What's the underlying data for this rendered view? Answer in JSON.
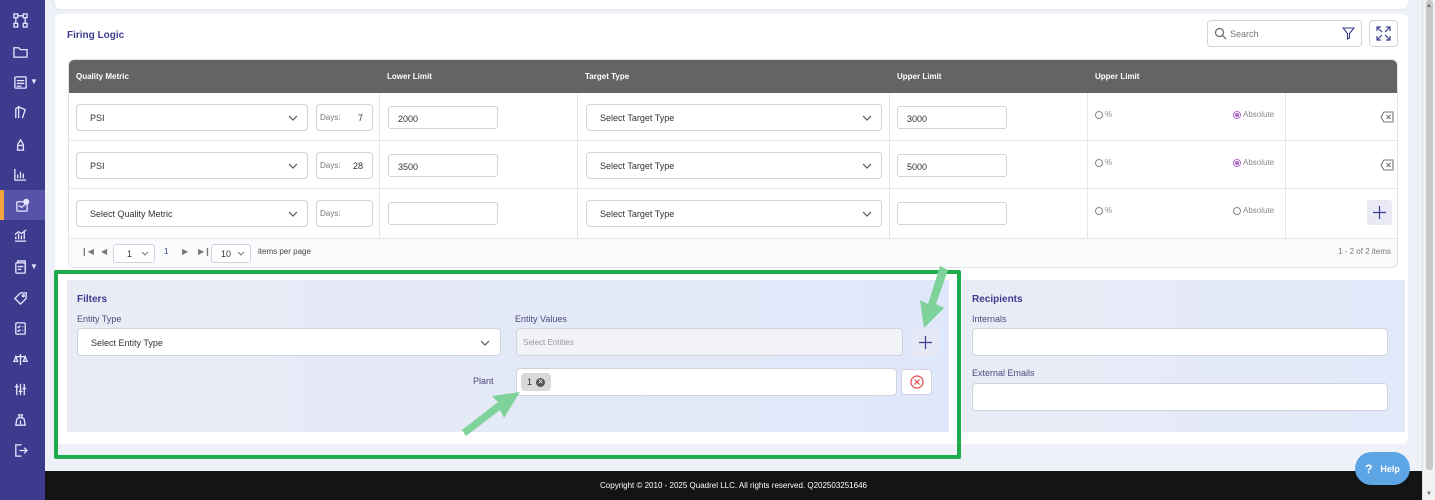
{
  "sidebar": {
    "icons": [
      "workflow-icon",
      "folder-icon",
      "form-icon",
      "document-edit-icon",
      "lab-icon",
      "bar-chart-icon",
      "alert-settings-icon",
      "analytics-chart-icon",
      "reports-icon",
      "tag-icon",
      "checklist-icon",
      "scale-icon",
      "sliders-icon",
      "money-bag-icon",
      "logout-icon"
    ],
    "active": "alert-settings-icon"
  },
  "section": {
    "title": "Firing Logic",
    "search_placeholder": "Search"
  },
  "grid": {
    "headers": [
      "Quality Metric",
      "Lower Limit",
      "Target Type",
      "Upper Limit",
      "Upper Limit"
    ],
    "rows": [
      {
        "metric": "PSI",
        "days_label": "Days:",
        "days": "7",
        "lower": "2000",
        "target": "Select Target Type",
        "upper": "3000",
        "pct_label": "%",
        "abs_label": "Absolute",
        "selected": "Absolute"
      },
      {
        "metric": "PSI",
        "days_label": "Days:",
        "days": "28",
        "lower": "3500",
        "target": "Select Target Type",
        "upper": "5000",
        "pct_label": "%",
        "abs_label": "Absolute",
        "selected": "Absolute"
      },
      {
        "metric": "Select Quality Metric",
        "days_label": "Days:",
        "days": "",
        "lower": "",
        "target": "Select Target Type",
        "upper": "",
        "pct_label": "%",
        "abs_label": "Absolute",
        "selected": ""
      }
    ],
    "pager": {
      "page_select": "1",
      "current_page": "1",
      "page_size": "10",
      "items_per_page_label": "items per page",
      "summary": "1 - 2 of 2 items"
    }
  },
  "filters": {
    "title": "Filters",
    "entity_type_label": "Entity Type",
    "entity_type_value": "Select Entity Type",
    "entity_values_label": "Entity Values",
    "entity_values_placeholder": "Select Entities",
    "plant_label": "Plant",
    "plant_chip": "1"
  },
  "recipients": {
    "title": "Recipients",
    "internals_label": "Internals",
    "external_label": "External Emails"
  },
  "footer": {
    "copyright": "Copyright © 2010 - 2025 Quadrel LLC. All rights reserved. Q202503251646"
  },
  "help": {
    "label": "Help"
  },
  "annotation": {
    "highlight_color": "#1faa4c",
    "arrow_color": "#7fd39a"
  },
  "colors": {
    "sidebar": "#3d3b8e",
    "accent": "#f4a340",
    "header": "#646464",
    "radio_selected": "#b06cc9"
  }
}
